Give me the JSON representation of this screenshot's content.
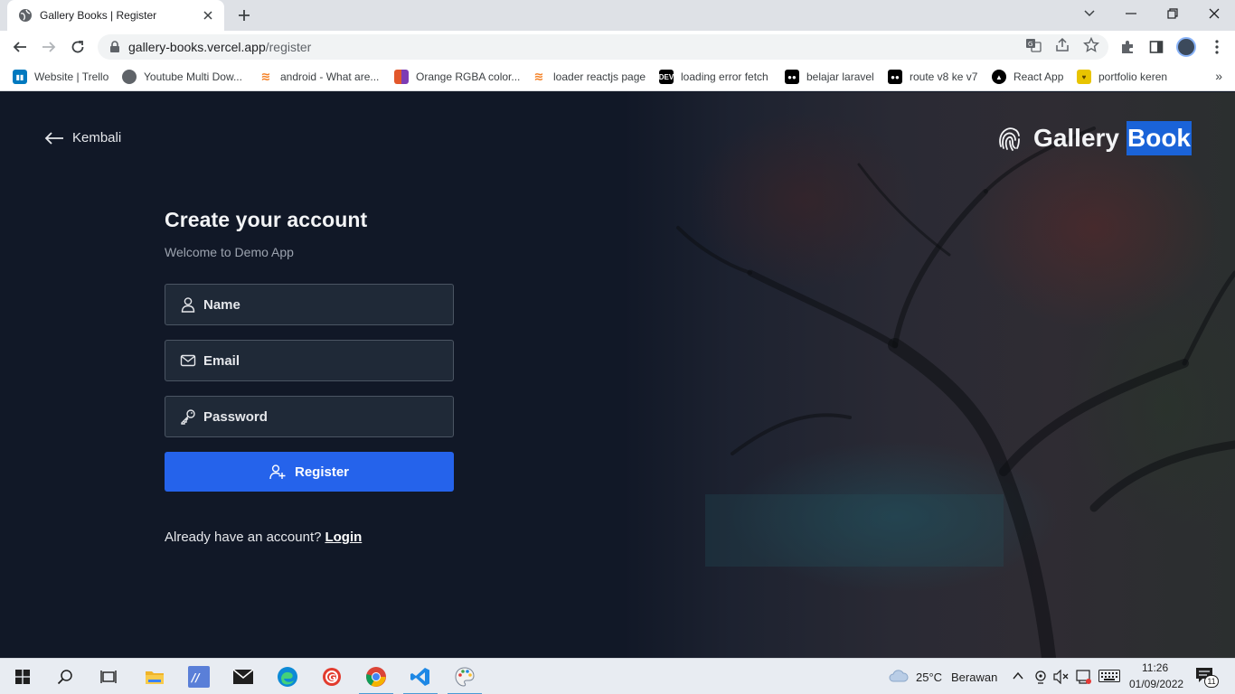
{
  "browser": {
    "tab_title": "Gallery Books | Register",
    "url_host": "gallery-books.vercel.app",
    "url_path": "/register",
    "bookmarks": [
      {
        "label": "Website | Trello",
        "color": "#0079bf"
      },
      {
        "label": "Youtube Multi Dow...",
        "color": "#5f6368"
      },
      {
        "label": "android - What are...",
        "color": "#f48024"
      },
      {
        "label": "Orange RGBA color...",
        "color": "#e2572b"
      },
      {
        "label": "loader reactjs page",
        "color": "#f48024"
      },
      {
        "label": "loading error fetch",
        "color": "#000000"
      },
      {
        "label": "belajar laravel",
        "color": "#000000"
      },
      {
        "label": "route v8 ke v7",
        "color": "#000000"
      },
      {
        "label": "React App",
        "color": "#000000"
      },
      {
        "label": "portfolio keren",
        "color": "#e8c400"
      }
    ],
    "bookmarks_more": "»"
  },
  "page": {
    "back_label": "Kembali",
    "brand_word1": "Gallery",
    "brand_word2": "Book",
    "title": "Create your account",
    "subtitle": "Welcome to Demo App",
    "name_placeholder": "Name",
    "email_placeholder": "Email",
    "password_placeholder": "Password",
    "register_label": "Register",
    "login_prompt": "Already have an account?",
    "login_link": "Login",
    "accent_color": "#2563eb"
  },
  "taskbar": {
    "weather_temp": "25°C",
    "weather_desc": "Berawan",
    "time": "11:26",
    "date": "01/09/2022",
    "notification_count": "11"
  }
}
